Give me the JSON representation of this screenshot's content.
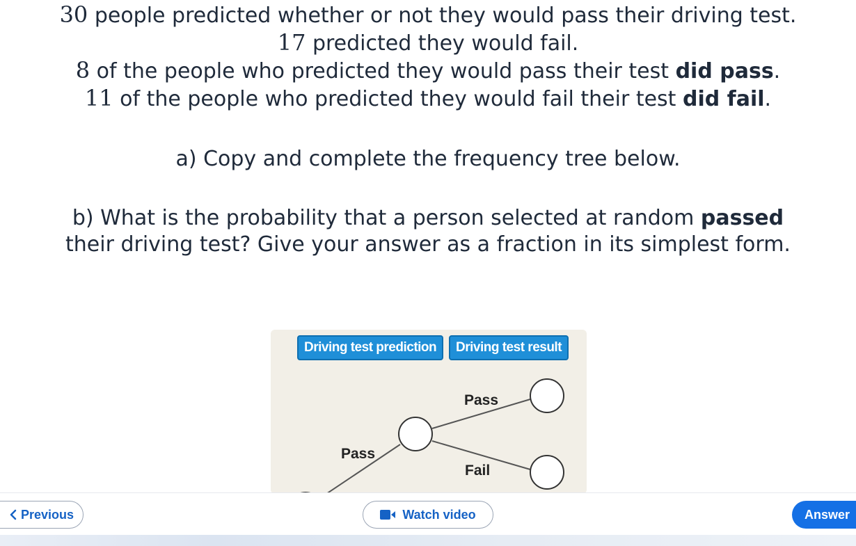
{
  "question": {
    "line1": {
      "num": "30",
      "text": " people predicted whether or not they would pass their driving test."
    },
    "line2": {
      "num": "17",
      "text": " predicted they would fail."
    },
    "line3": {
      "num": "8",
      "text": " of the people who predicted they would pass their test ",
      "bold": "did pass",
      "end": "."
    },
    "line4": {
      "num": "11",
      "text": " of the people who predicted they would fail their test ",
      "bold": "did fail",
      "end": "."
    },
    "part_a": "a) Copy and complete the frequency tree below.",
    "part_b1_pre": "b) What is the probability that a person selected at random ",
    "part_b1_bold": "passed",
    "part_b2": "their driving test? Give your answer as a fraction in its simplest form."
  },
  "tree": {
    "header_prediction": "Driving test prediction",
    "header_result": "Driving test result",
    "label_pass_prediction": "Pass",
    "label_pass_result": "Pass",
    "label_fail_result": "Fail"
  },
  "nav": {
    "previous": "Previous",
    "watch_video": "Watch video",
    "answer": "Answer"
  },
  "colors": {
    "accent": "#1570e5",
    "header_blue": "#1f8fd8",
    "tree_bg": "#f2efe7",
    "text": "#1f2a3a"
  },
  "icons": {
    "previous": "chevron-left-icon",
    "video": "video-camera-icon"
  }
}
